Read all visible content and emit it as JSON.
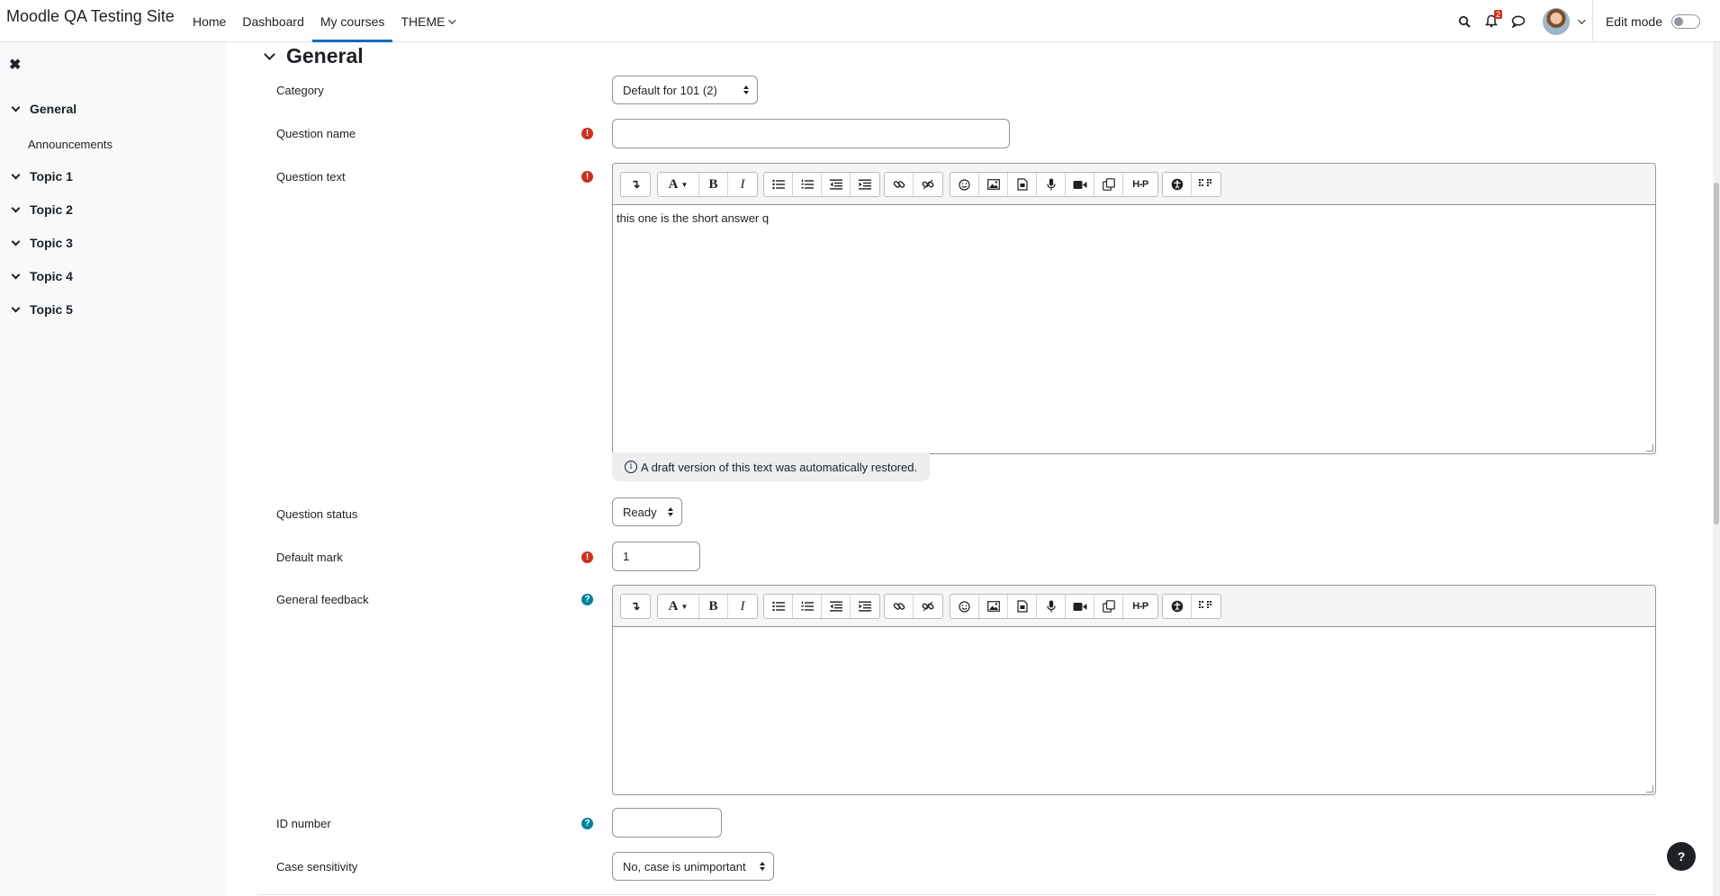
{
  "site": {
    "name": "Moodle QA Testing Site"
  },
  "nav": {
    "items": [
      {
        "label": "Home"
      },
      {
        "label": "Dashboard"
      },
      {
        "label": "My courses"
      },
      {
        "label": "THEME"
      }
    ],
    "active": "My courses",
    "notification_count": "2",
    "edit_mode_label": "Edit mode"
  },
  "drawer": {
    "close_icon": "close-icon",
    "sections": [
      {
        "label": "General",
        "children": [
          {
            "label": "Announcements"
          }
        ]
      },
      {
        "label": "Topic 1"
      },
      {
        "label": "Topic 2"
      },
      {
        "label": "Topic 3"
      },
      {
        "label": "Topic 4"
      },
      {
        "label": "Topic 5"
      }
    ]
  },
  "form": {
    "legend": "General",
    "category": {
      "label": "Category",
      "value": "Default for 101 (2)"
    },
    "question_name": {
      "label": "Question name",
      "value": ""
    },
    "question_text": {
      "label": "Question text",
      "value": "this one is the short answer q"
    },
    "draft_notice": "A draft version of this text was automatically restored.",
    "question_status": {
      "label": "Question status",
      "value": "Ready"
    },
    "default_mark": {
      "label": "Default mark",
      "value": "1"
    },
    "general_feedback": {
      "label": "General feedback",
      "value": ""
    },
    "id_number": {
      "label": "ID number",
      "value": ""
    },
    "case_sensitivity": {
      "label": "Case sensitivity",
      "value": "No, case is unimportant"
    }
  },
  "editor_toolbar": {
    "icons": [
      "collapse-icon",
      "font-icon",
      "bold-icon",
      "italic-icon",
      "unordered-list-icon",
      "ordered-list-icon",
      "outdent-icon",
      "indent-icon",
      "link-icon",
      "unlink-icon",
      "emoji-icon",
      "image-icon",
      "media-file-icon",
      "microphone-icon",
      "video-icon",
      "manage-files-icon",
      "h5p-icon",
      "accessibility-checker-icon",
      "screenreader-helper-icon"
    ],
    "h5p_label": "H-P"
  },
  "help_button": "?",
  "colors": {
    "accent": "#0f6cbf",
    "required": "#ca3120",
    "help": "#008196"
  }
}
